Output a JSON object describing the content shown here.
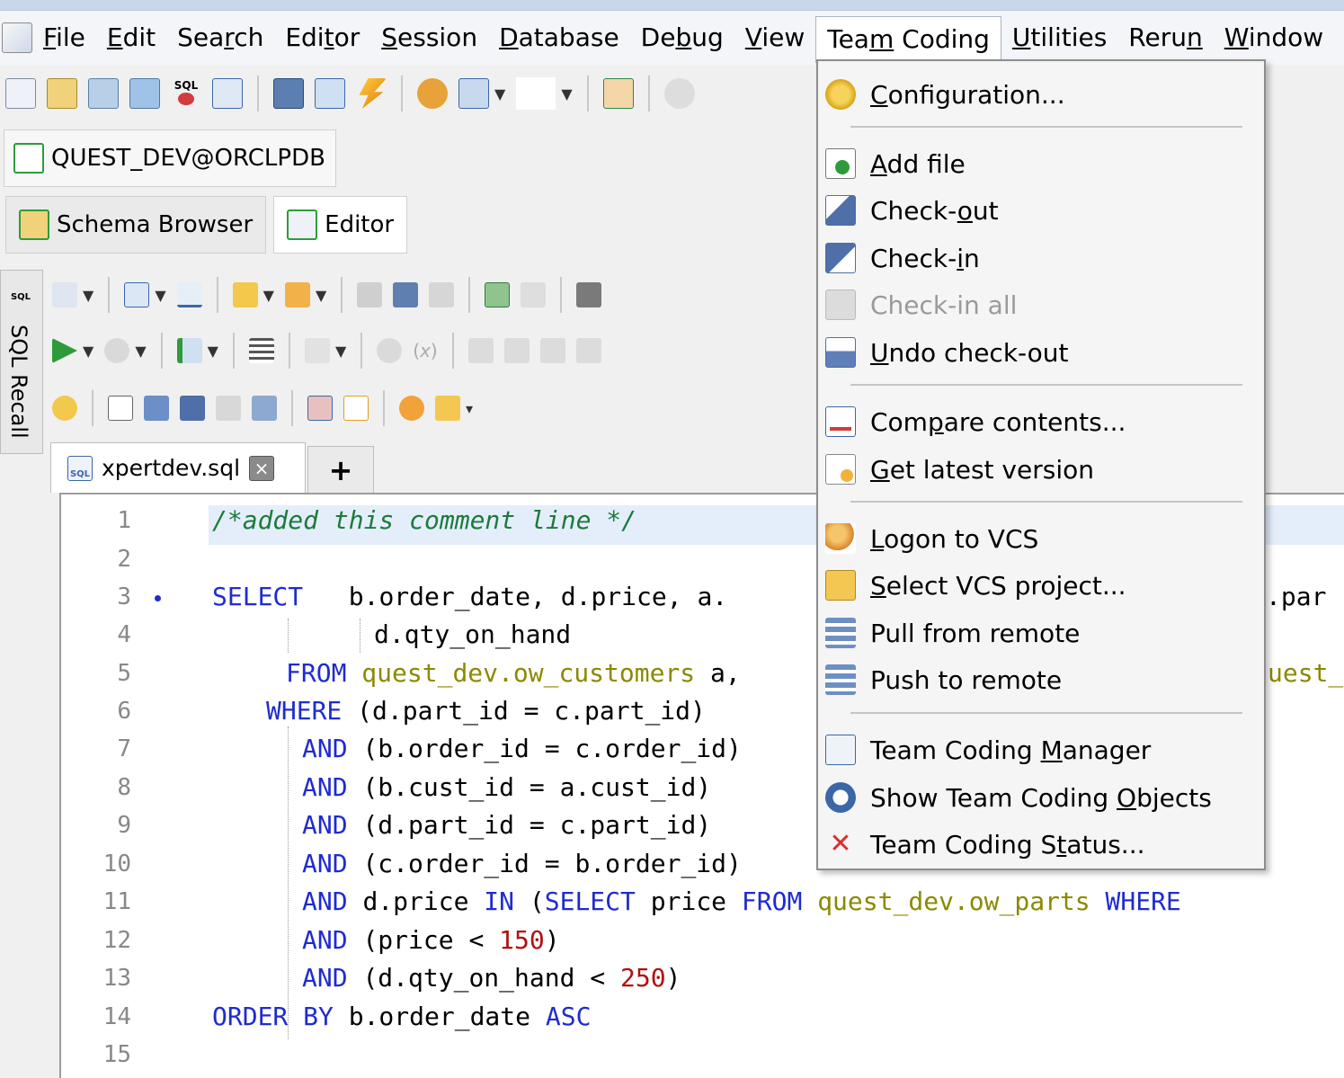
{
  "menubar": {
    "items": [
      {
        "pre": "",
        "u": "F",
        "post": "ile"
      },
      {
        "pre": "",
        "u": "E",
        "post": "dit"
      },
      {
        "pre": "Sea",
        "u": "r",
        "post": "ch"
      },
      {
        "pre": "Edi",
        "u": "t",
        "post": "or"
      },
      {
        "pre": "",
        "u": "S",
        "post": "ession"
      },
      {
        "pre": "",
        "u": "D",
        "post": "atabase"
      },
      {
        "pre": "De",
        "u": "b",
        "post": "ug"
      },
      {
        "pre": "",
        "u": "V",
        "post": "iew"
      },
      {
        "pre": "Tea",
        "u": "m",
        "post": " Coding"
      },
      {
        "pre": "",
        "u": "U",
        "post": "tilities"
      },
      {
        "pre": "Reru",
        "u": "n",
        "post": ""
      },
      {
        "pre": "",
        "u": "W",
        "post": "indow"
      }
    ]
  },
  "connection": {
    "label": "QUEST_DEV@ORCLPDB"
  },
  "doc_tabs": {
    "schema": "Schema Browser",
    "editor": "Editor"
  },
  "side_panel": {
    "label": "SQL Recall",
    "icon_text": "SQL"
  },
  "file_tab": {
    "name": "xpertdev.sql",
    "icon_text": "SQL",
    "add": "+"
  },
  "toolbar": {
    "sql_icon_text": "SQL"
  },
  "code": {
    "line_numbers": [
      "1",
      "2",
      "3",
      "4",
      "5",
      "6",
      "7",
      "8",
      "9",
      "10",
      "11",
      "12",
      "13",
      "14",
      "15"
    ],
    "l1": "/*added this comment line */",
    "l3_kw": "SELECT",
    "l3_rest": "   b.order_date, d.price, a.",
    "l3_tail": ".par",
    "l4": "d.qty_on_hand",
    "l5_kw": "FROM",
    "l5_tbl": "quest_dev.ow_customers",
    "l5_rest": " a,",
    "l5_tail": "uest_",
    "l6_kw": "WHERE",
    "l6_rest": "(d.part_id = c.part_id)",
    "l7_kw": "AND",
    "l7_rest": "(b.order_id = c.order_id)",
    "l8_kw": "AND",
    "l8_rest": "(b.cust_id = a.cust_id)",
    "l9_kw": "AND",
    "l9_rest": "(d.part_id = c.part_id)",
    "l10_kw": "AND",
    "l10_rest": "(c.order_id = b.order_id)",
    "l11_kw": "AND",
    "l11_a": "d.price ",
    "l11_in": "IN",
    "l11_b": " (",
    "l11_sel": "SELECT",
    "l11_c": " price ",
    "l11_from": "FROM",
    "l11_tbl": "quest_dev.ow_parts",
    "l11_where": "WHERE",
    "l12_kw": "AND",
    "l12_a": "(price < ",
    "l12_num": "150",
    "l12_b": ")",
    "l13_kw": "AND",
    "l13_a": "(d.qty_on_hand < ",
    "l13_num": "250",
    "l13_b": ")",
    "l14_kw": "ORDER BY",
    "l14_a": " b.order_date ",
    "l14_asc": "ASC"
  },
  "dropdown": {
    "configuration": {
      "pre": "",
      "u": "C",
      "post": "onfiguration..."
    },
    "add_file": {
      "pre": "",
      "u": "A",
      "post": "dd file"
    },
    "check_out": {
      "pre": "Check-",
      "u": "o",
      "post": "ut"
    },
    "check_in": {
      "pre": "Check-",
      "u": "i",
      "post": "n"
    },
    "check_in_all": {
      "pre": "Check-in all",
      "u": "",
      "post": ""
    },
    "undo_check_out": {
      "pre": "",
      "u": "U",
      "post": "ndo check-out"
    },
    "compare": {
      "pre": "Com",
      "u": "p",
      "post": "are contents..."
    },
    "get_latest": {
      "pre": "",
      "u": "G",
      "post": "et latest version"
    },
    "logon": {
      "pre": "",
      "u": "L",
      "post": "ogon to VCS"
    },
    "select_project": {
      "pre": "",
      "u": "S",
      "post": "elect VCS project..."
    },
    "pull": {
      "pre": "Pull from remote",
      "u": "",
      "post": ""
    },
    "push": {
      "pre": "Push to remote",
      "u": "",
      "post": ""
    },
    "manager": {
      "pre": "Team Coding ",
      "u": "M",
      "post": "anager"
    },
    "show_objects": {
      "pre": "Show Team Coding ",
      "u": "O",
      "post": "bjects"
    },
    "status": {
      "pre": "Team Coding S",
      "u": "t",
      "post": "atus..."
    }
  },
  "colors": {
    "keyword": "#1f2bd0",
    "table": "#8a8a00",
    "number": "#b01010",
    "comment": "#1d7a3a",
    "accent_green": "#2e9b3a"
  }
}
